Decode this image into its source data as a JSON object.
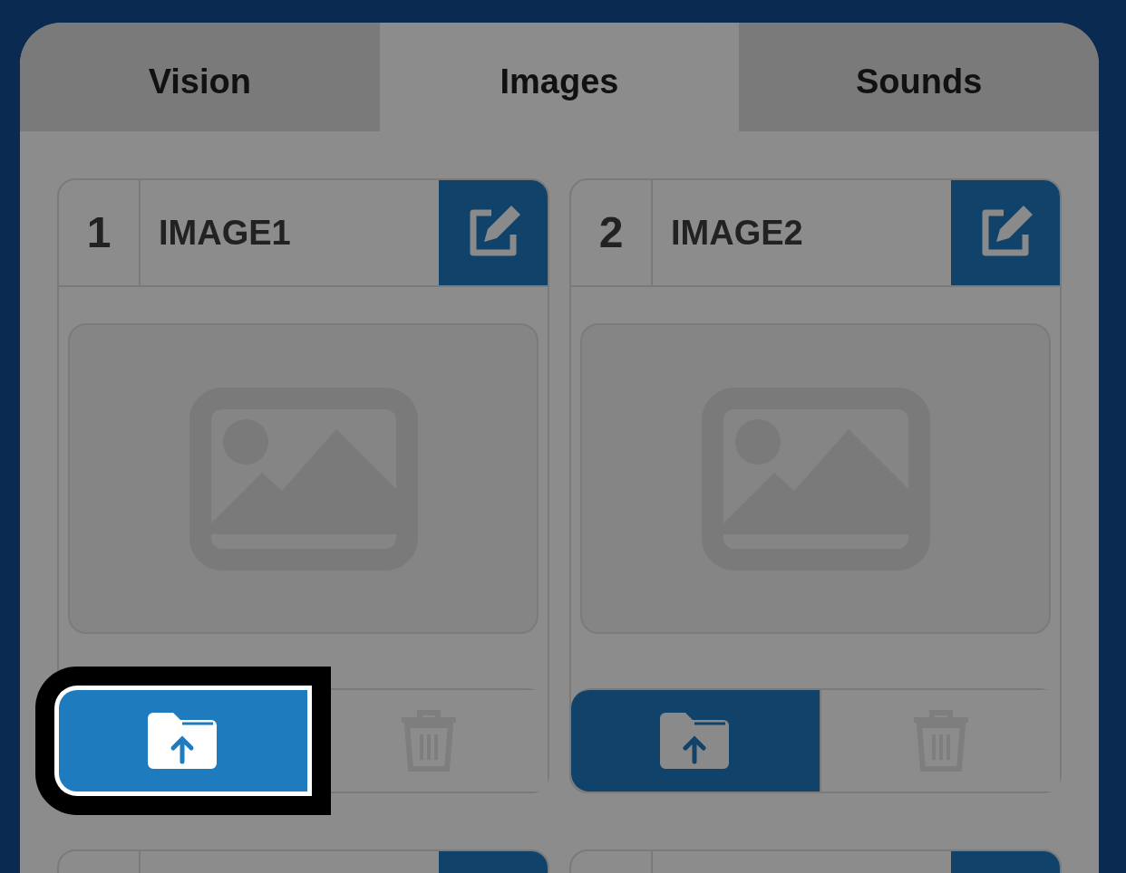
{
  "tabs": [
    {
      "label": "Vision",
      "selected": false
    },
    {
      "label": "Images",
      "selected": true
    },
    {
      "label": "Sounds",
      "selected": false
    }
  ],
  "images": [
    {
      "kind": "full",
      "number": "1",
      "name": "IMAGE1",
      "highlighted": true
    },
    {
      "kind": "full",
      "number": "2",
      "name": "IMAGE2",
      "highlighted": false
    },
    {
      "kind": "partial"
    },
    {
      "kind": "partial"
    }
  ]
}
